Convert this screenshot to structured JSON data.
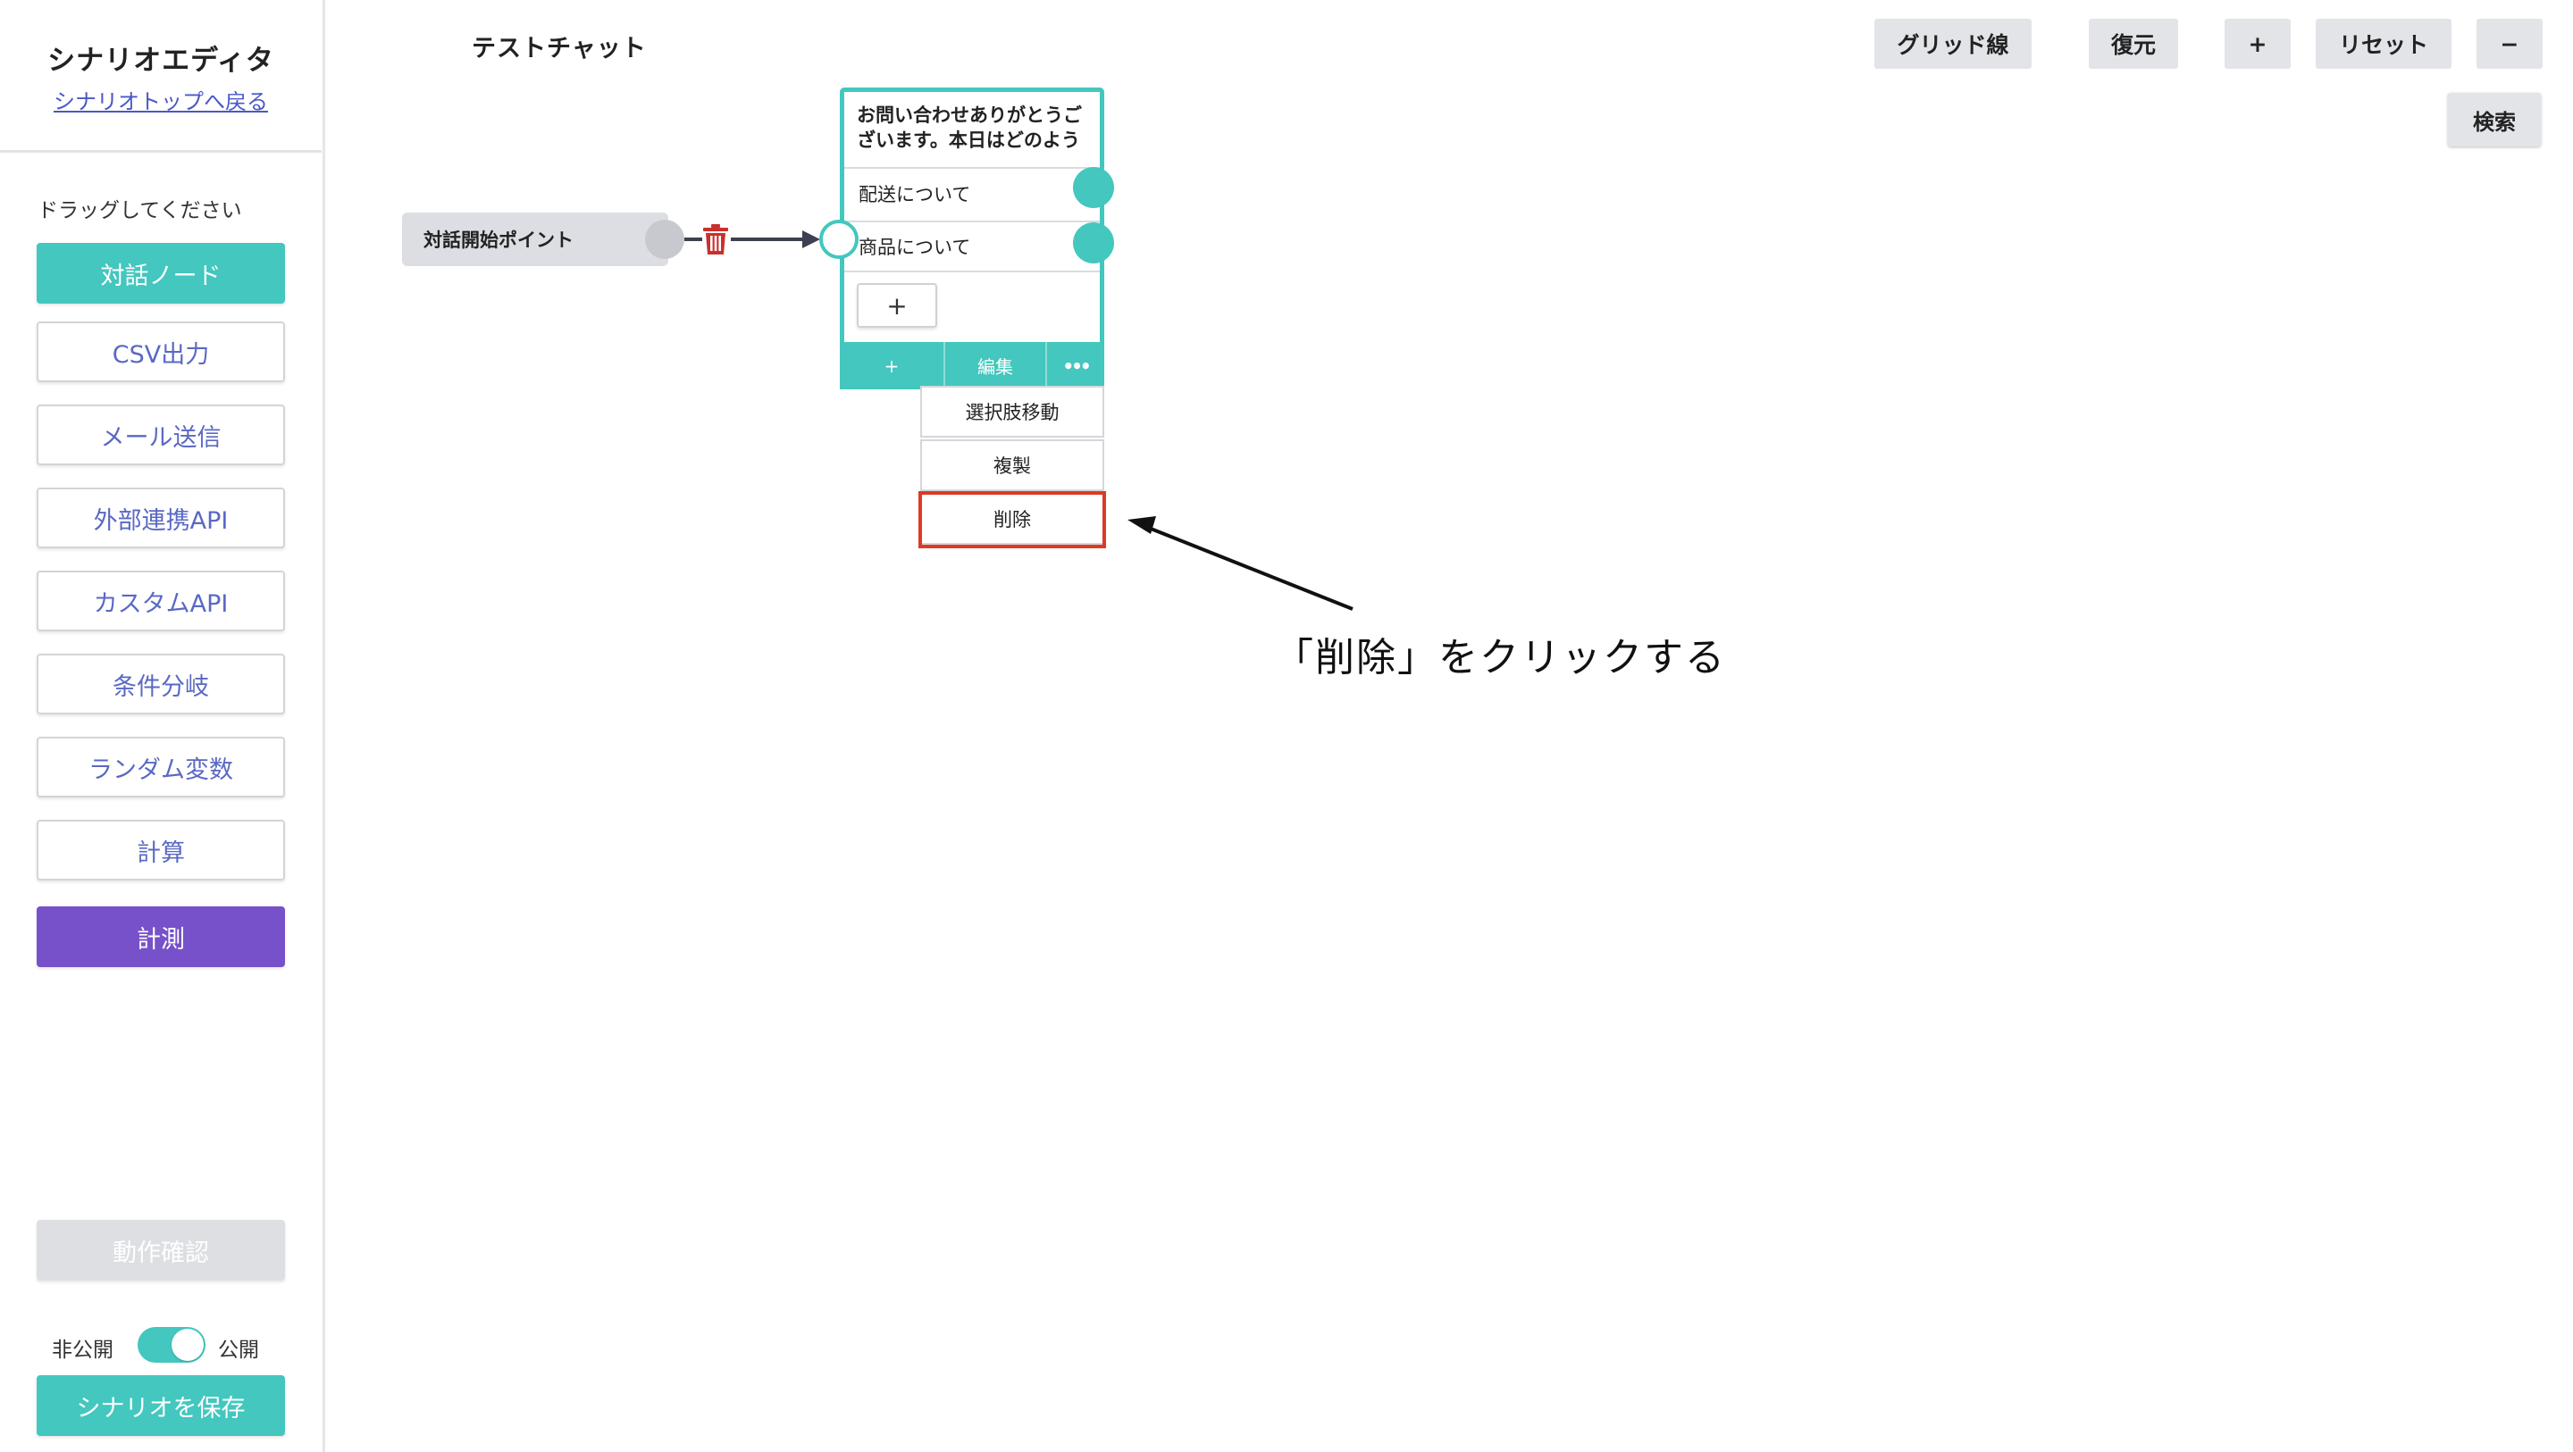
{
  "sidebar": {
    "title": "シナリオエディタ",
    "back_link": "シナリオトップへ戻る",
    "drag_hint": "ドラッグしてください",
    "tools": {
      "dialog_node": "対話ノード",
      "csv": "CSV出力",
      "mail": "メール送信",
      "external_api": "外部連携API",
      "custom_api": "カスタムAPI",
      "condition": "条件分岐",
      "random_var": "ランダム変数",
      "calc": "計算",
      "measure": "計測"
    },
    "preview": "動作確認",
    "toggle": {
      "off_label": "非公開",
      "on_label": "公開",
      "state": "on"
    },
    "save": "シナリオを保存"
  },
  "canvas": {
    "chat_title": "テストチャット",
    "toolbar": {
      "grid": "グリッド線",
      "restore": "復元",
      "zoom_in": "+",
      "reset": "リセット",
      "zoom_out": "−",
      "search": "検索"
    },
    "start_node": {
      "label": "対話開始ポイント"
    },
    "dialog_node": {
      "message": "お問い合わせありがとうございます。本日はどのよう",
      "choices": [
        "配送について",
        "商品について"
      ],
      "add_choice": "+",
      "footer": {
        "add": "+",
        "edit": "編集",
        "more": "•••"
      }
    },
    "menu": {
      "move_choice": "選択肢移動",
      "duplicate": "複製",
      "delete": "削除"
    },
    "annotation": "「削除」をクリックする"
  },
  "colors": {
    "teal": "#43c7be",
    "purple": "#7751c9",
    "link": "#4a57c8",
    "highlight": "#dd3a22",
    "trash": "#c9302c"
  },
  "icons": {
    "trash": "trash-icon",
    "arrow": "pointer-arrow"
  }
}
